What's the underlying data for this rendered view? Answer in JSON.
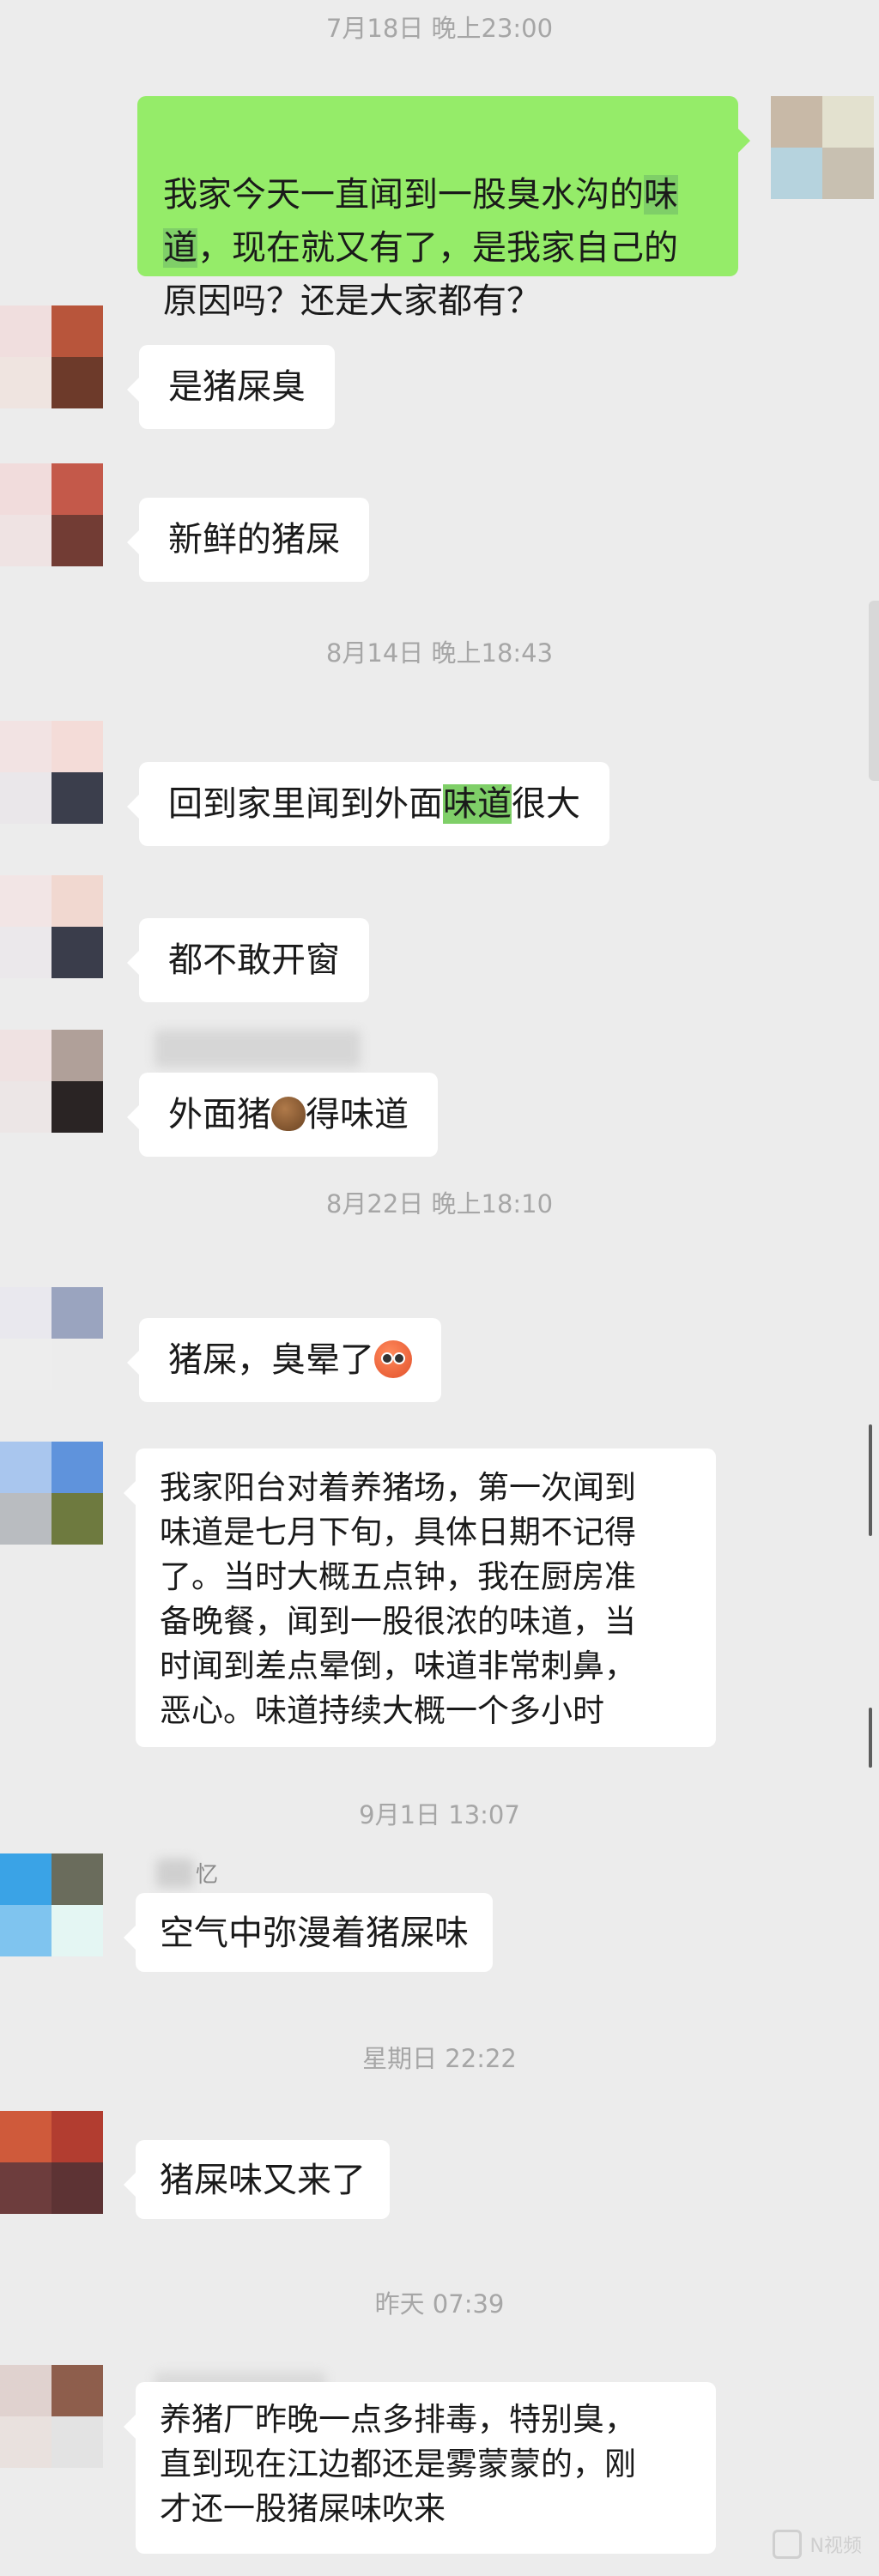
{
  "timestamps": [
    "7月18日 晚上23:00",
    "8月14日 晚上18:43",
    "8月22日 晚上18:10",
    "9月1日 13:07",
    "星期日 22:22",
    "昨天 07:39"
  ],
  "messages": {
    "m1": {
      "text_a": "我家今天一直闻到一股臭水沟的",
      "hl_a": "味",
      "text_b": "\n",
      "hl_b": "道",
      "text_c": "，现在就又有了，是我家自己的\n原因吗？还是大家都有？"
    },
    "m2": "是猪屎臭",
    "m3": "新鲜的猪屎",
    "m4": {
      "before": "回到家里闻到外面",
      "hl": "味道",
      "after": "很大"
    },
    "m5": "都不敢开窗",
    "m6": {
      "before": "外面猪",
      "after": "得味道"
    },
    "m7": "猪屎，臭晕了",
    "m8": "我家阳台对着养猪场，第一次闻到\n味道是七月下旬，具体日期不记得\n了。当时大概五点钟，我在厨房准\n备晚餐，闻到一股很浓的味道，当\n时闻到差点晕倒，味道非常刺鼻，\n恶心。味道持续大概一个多小时",
    "m9": "空气中弥漫着猪屎味",
    "m10": "猪屎味又来了",
    "m11": "养猪厂昨晚一点多排毒，特别臭，\n直到现在江边都还是雾蒙蒙的，刚\n才还一股猪屎味吹来"
  },
  "sender_partial": "忆",
  "watermark": "N视频",
  "colors": {
    "background": "#ececec",
    "bubble_self": "#95ec69",
    "bubble_other": "#ffffff",
    "highlight": "#7fcf68",
    "timestamp": "#a6a6a6"
  }
}
